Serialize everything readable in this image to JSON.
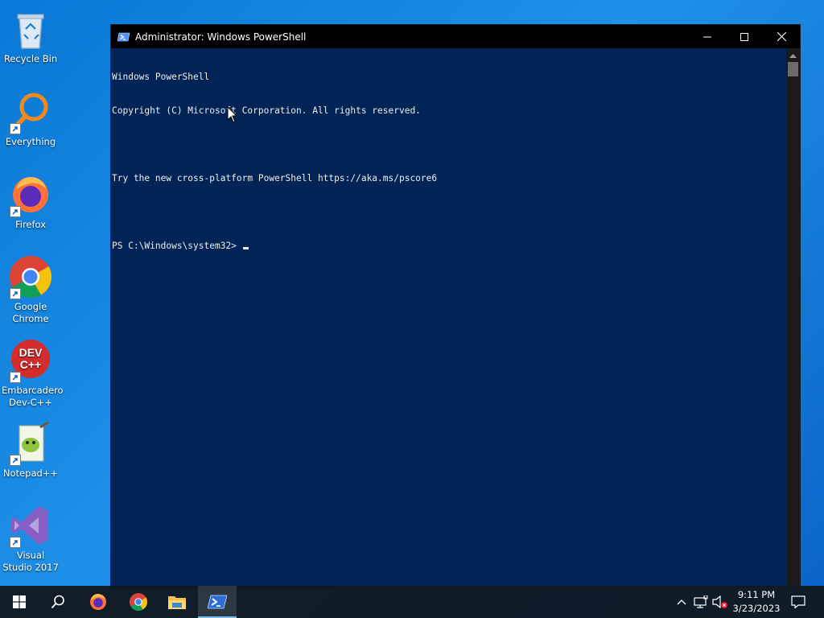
{
  "desktop": {
    "icons": [
      {
        "label": "Recycle Bin"
      },
      {
        "label": "Everything"
      },
      {
        "label": "Firefox"
      },
      {
        "label": "Google Chrome"
      },
      {
        "label": "Embarcadero Dev-C++"
      },
      {
        "label": "Notepad++"
      },
      {
        "label": "Visual Studio 2017"
      }
    ],
    "devcpp_logo_text": "DEV\nC++"
  },
  "window": {
    "title": "Administrator: Windows PowerShell",
    "icon": "powershell-icon",
    "controls": {
      "minimize": "minimize-icon",
      "maximize": "maximize-icon",
      "close": "close-icon"
    },
    "background": "#012456",
    "console_lines": [
      "Windows PowerShell",
      "Copyright (C) Microsoft Corporation. All rights reserved.",
      "",
      "Try the new cross-platform PowerShell https://aka.ms/pscore6",
      ""
    ],
    "prompt": "PS C:\\Windows\\system32>"
  },
  "taskbar": {
    "pinned": [
      "windows-start-icon",
      "search-icon",
      "firefox-icon",
      "chrome-icon",
      "file-explorer-icon",
      "powershell-icon"
    ],
    "active": "powershell-icon",
    "tray": [
      "chevron-up-icon",
      "network-icon",
      "volume-muted-icon",
      "notification-icon"
    ],
    "clock": {
      "time": "9:11 PM",
      "date": "3/23/2023"
    }
  }
}
